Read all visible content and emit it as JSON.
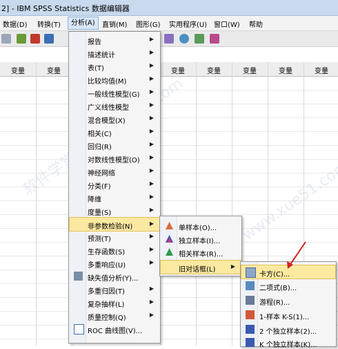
{
  "window": {
    "title": "2] - IBM SPSS Statistics 数据编辑器"
  },
  "menubar": [
    {
      "label": "数据(D)"
    },
    {
      "label": "转换(T)"
    },
    {
      "label": "分析(A)"
    },
    {
      "label": "直销(M)"
    },
    {
      "label": "图形(G)"
    },
    {
      "label": "实用程序(U)"
    },
    {
      "label": "窗口(W)"
    },
    {
      "label": "帮助"
    }
  ],
  "grid": {
    "column_header": "变量"
  },
  "analyze_menu": [
    {
      "label": "报告"
    },
    {
      "label": "描述统计"
    },
    {
      "label": "表(T)"
    },
    {
      "label": "比较均值(M)"
    },
    {
      "label": "一般线性模型(G)"
    },
    {
      "label": "广义线性模型"
    },
    {
      "label": "混合模型(X)"
    },
    {
      "label": "相关(C)"
    },
    {
      "label": "回归(R)"
    },
    {
      "label": "对数线性模型(O)"
    },
    {
      "label": "神经网络"
    },
    {
      "label": "分类(F)"
    },
    {
      "label": "降维"
    },
    {
      "label": "度量(S)"
    },
    {
      "label": "非参数检验(N)"
    },
    {
      "label": "预测(T)"
    },
    {
      "label": "生存函数(S)"
    },
    {
      "label": "多重响应(U)"
    },
    {
      "label": "缺失值分析(Y)..."
    },
    {
      "label": "多重归因(T)"
    },
    {
      "label": "复杂抽样(L)"
    },
    {
      "label": "质量控制(Q)"
    },
    {
      "label": "ROC 曲线图(V)..."
    }
  ],
  "nonparam_menu": [
    {
      "label": "单样本(O)..."
    },
    {
      "label": "独立样本(I)..."
    },
    {
      "label": "相关样本(R)..."
    },
    {
      "label": "旧对话框(L)"
    }
  ],
  "legacy_menu": [
    {
      "label": "卡方(C)..."
    },
    {
      "label": "二项式(B)..."
    },
    {
      "label": "游程(R)..."
    },
    {
      "label": "1-样本 K-S(1)..."
    },
    {
      "label": "2 个独立样本(2)..."
    },
    {
      "label": "K 个独立样本(K)..."
    }
  ],
  "watermark": "软件学堂 www.xue51.com",
  "colors": {
    "highlight": "#fbe9a1",
    "menu_bg": "#f5f5f5",
    "arrow": "#d42020"
  }
}
